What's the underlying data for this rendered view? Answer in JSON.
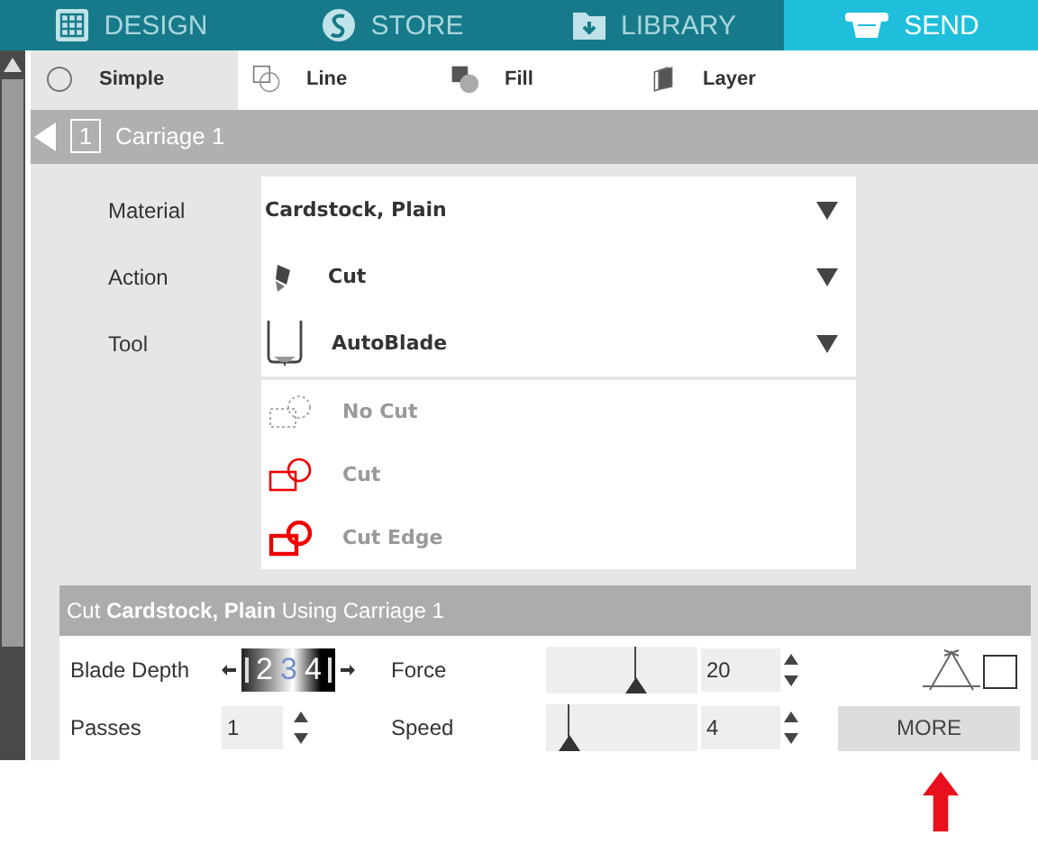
{
  "nav_tabs": [
    {
      "label": "DESIGN",
      "selected": false
    },
    {
      "label": "STORE",
      "selected": false
    },
    {
      "label": "LIBRARY",
      "selected": false
    },
    {
      "label": "SEND",
      "selected": true
    }
  ],
  "mode_tabs": [
    {
      "label": "Simple",
      "selected": true
    },
    {
      "label": "Line",
      "selected": false
    },
    {
      "label": "Fill",
      "selected": false
    },
    {
      "label": "Layer",
      "selected": false
    }
  ],
  "carriage": {
    "number": "1",
    "title": "Carriage 1"
  },
  "settings": [
    {
      "label": "Material",
      "value": "Cardstock, Plain"
    },
    {
      "label": "Action",
      "value": "Cut"
    },
    {
      "label": "Tool",
      "value": "AutoBlade"
    }
  ],
  "cut_options": [
    {
      "label": "No Cut",
      "kind": "nocut"
    },
    {
      "label": "Cut",
      "kind": "cut"
    },
    {
      "label": "Cut Edge",
      "kind": "cutedge"
    }
  ],
  "summary": {
    "title": "Cut **Cardstock, Plain** Using Carriage 1",
    "blade_depth": {
      "label": "Blade Depth",
      "digits": [
        {
          "text": "2",
          "selected": false
        },
        {
          "text": "3",
          "selected": true
        },
        {
          "text": "4",
          "selected": false
        }
      ]
    },
    "passes": {
      "label": "Passes",
      "value": "1"
    },
    "force": {
      "label": "Force",
      "level": 0.6,
      "value": "20"
    },
    "speed": {
      "label": "Speed",
      "level": 0.15,
      "value": "4"
    },
    "more_button": "MORE"
  }
}
